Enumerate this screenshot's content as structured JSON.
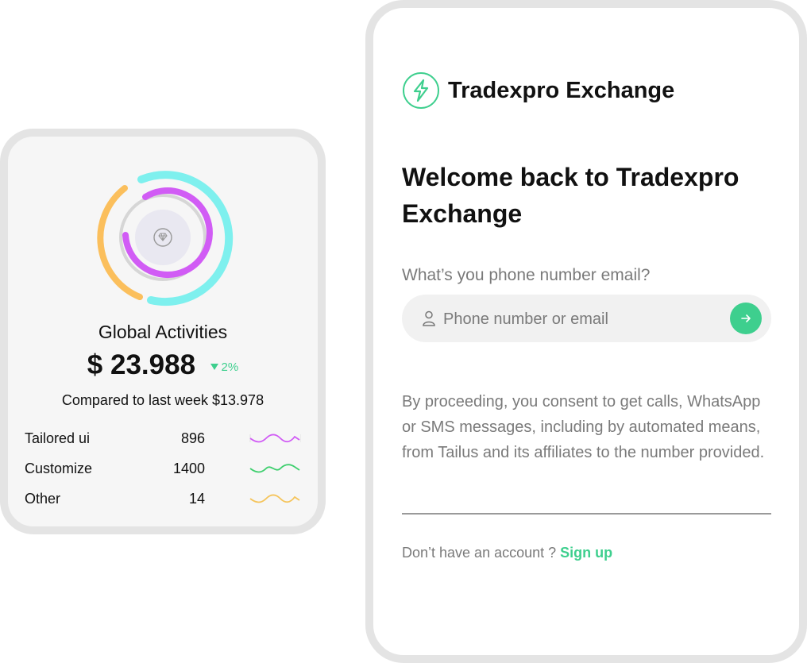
{
  "stats": {
    "title": "Global Activities",
    "value": "$ 23.988",
    "change": "2%",
    "compare": "Compared to last week $13.978",
    "ring_colors": {
      "outer": "#7ef0ee",
      "outer_alt": "#fbbf5c",
      "inner": "#d15cf5",
      "track": "#d6d6d6"
    },
    "center_icon": "diamond-icon",
    "rows": [
      {
        "label": "Tailored ui",
        "value": "896",
        "color": "#d15cf5"
      },
      {
        "label": "Customize",
        "value": "1400",
        "color": "#3ecf6e"
      },
      {
        "label": "Other",
        "value": "14",
        "color": "#f5c45a"
      }
    ]
  },
  "login": {
    "brand_name": "Tradexpro Exchange",
    "brand_icon": "bolt-logo-icon",
    "accent_color": "#3ecf8e",
    "welcome": "Welcome back to Tradexpro Exchange",
    "question": "What’s you phone number email?",
    "input": {
      "placeholder": "Phone number or email",
      "value": ""
    },
    "consent": "By proceeding, you consent to get calls, WhatsApp or SMS messages, including by automated means, from Tailus and its affiliates to the number provided.",
    "no_account": "Don’t have an account ?",
    "signup": "Sign up"
  }
}
